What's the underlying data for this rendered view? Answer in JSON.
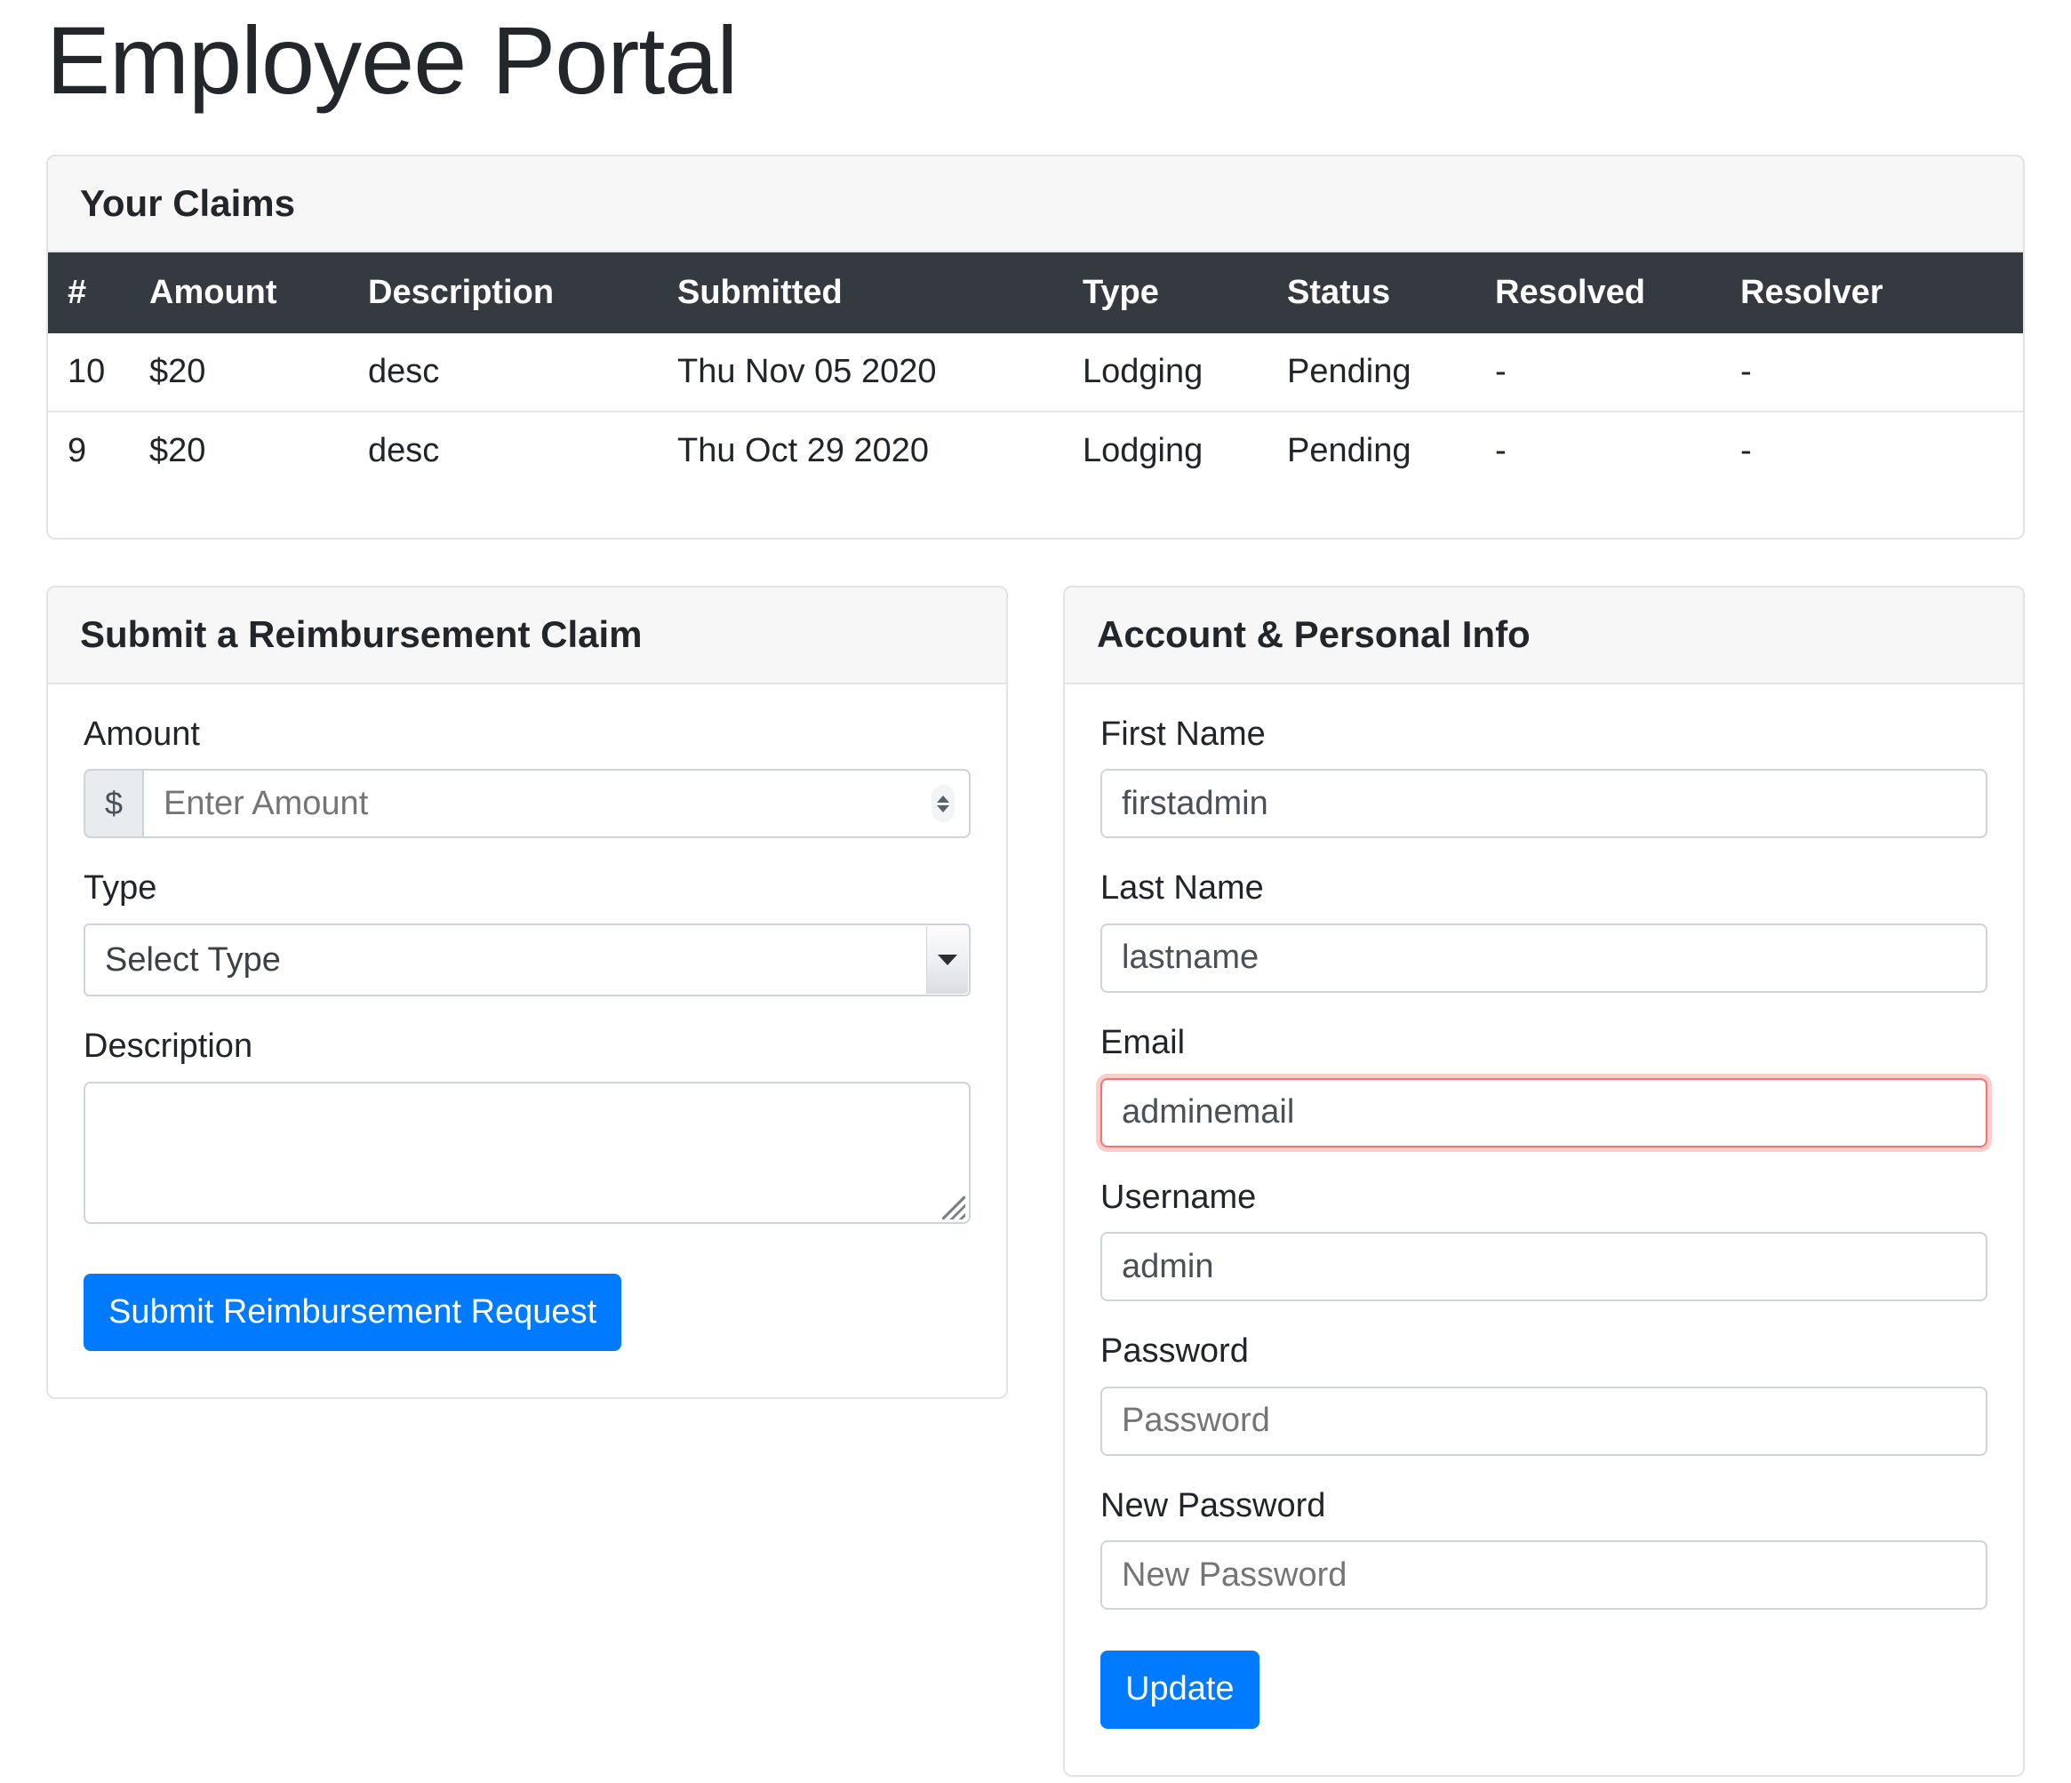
{
  "page": {
    "title": "Employee Portal"
  },
  "claims": {
    "card_title": "Your Claims",
    "columns": [
      "#",
      "Amount",
      "Description",
      "Submitted",
      "Type",
      "Status",
      "Resolved",
      "Resolver"
    ],
    "rows": [
      {
        "num": "10",
        "amount": "$20",
        "description": "desc",
        "submitted": "Thu Nov 05 2020",
        "type": "Lodging",
        "status": "Pending",
        "resolved": "-",
        "resolver": "-"
      },
      {
        "num": "9",
        "amount": "$20",
        "description": "desc",
        "submitted": "Thu Oct 29 2020",
        "type": "Lodging",
        "status": "Pending",
        "resolved": "-",
        "resolver": "-"
      }
    ]
  },
  "claim_form": {
    "card_title": "Submit a Reimbursement Claim",
    "amount_label": "Amount",
    "amount_prefix": "$",
    "amount_placeholder": "Enter Amount",
    "amount_value": "",
    "type_label": "Type",
    "type_selected": "Select Type",
    "description_label": "Description",
    "description_value": "",
    "submit_label": "Submit Reimbursement Request"
  },
  "account": {
    "card_title": "Account & Personal Info",
    "first_name_label": "First Name",
    "first_name_value": "firstadmin",
    "last_name_label": "Last Name",
    "last_name_value": "lastname",
    "email_label": "Email",
    "email_value": "adminemail",
    "username_label": "Username",
    "username_value": "admin",
    "password_label": "Password",
    "password_placeholder": "Password",
    "password_value": "",
    "new_password_label": "New Password",
    "new_password_placeholder": "New Password",
    "new_password_value": "",
    "update_label": "Update"
  },
  "colors": {
    "primary": "#007bff",
    "table_header_bg": "#343a40",
    "card_header_bg": "#f7f7f7",
    "invalid_border": "#f4726f",
    "border": "#e3e3e3"
  }
}
